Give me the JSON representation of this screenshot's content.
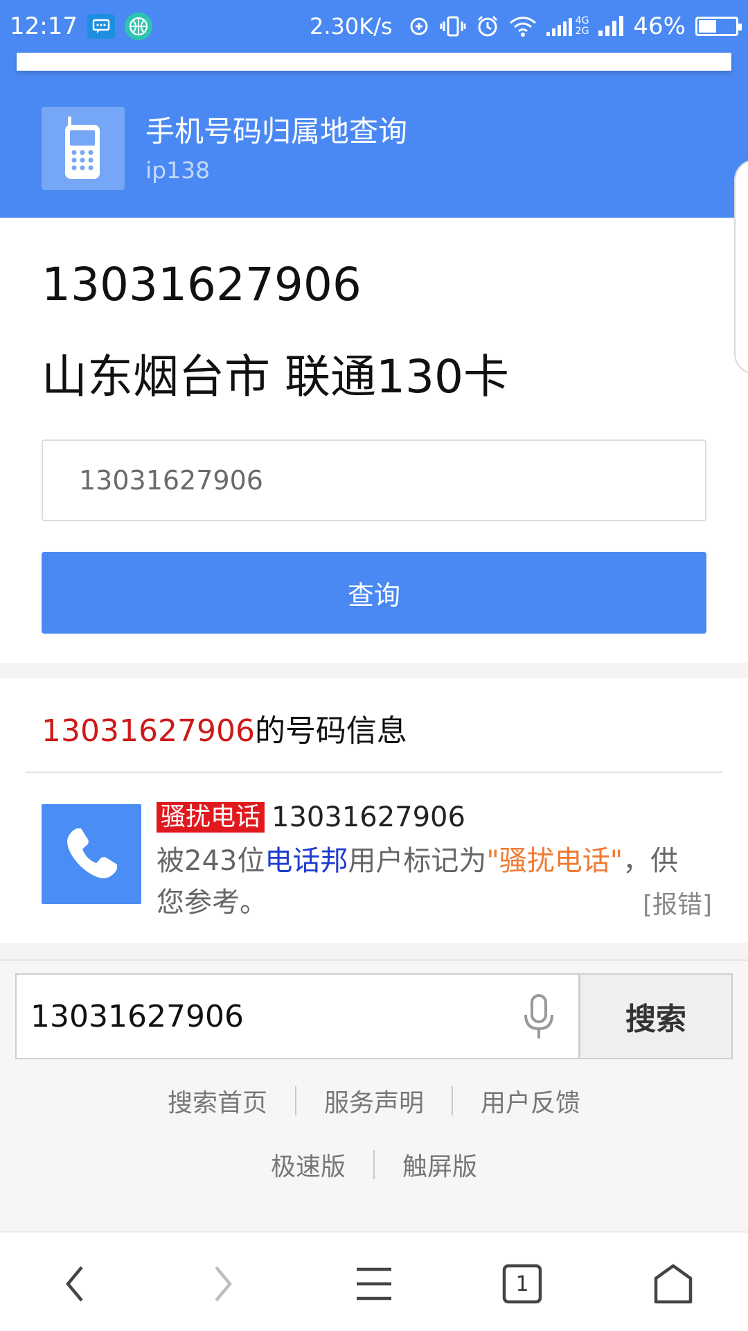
{
  "status_bar": {
    "time": "12:17",
    "speed": "2.30K/s",
    "network_4g": "4G",
    "network_2g": "2G",
    "battery_percent": "46%",
    "battery_level": 0.46
  },
  "header": {
    "title": "手机号码归属地查询",
    "subtitle": "ip138"
  },
  "result": {
    "number": "13031627906",
    "location": "山东烟台市 联通130卡"
  },
  "form": {
    "input_value": "13031627906",
    "query_label": "查询"
  },
  "info": {
    "heading_number": "13031627906",
    "heading_suffix": "的号码信息",
    "tag": "骚扰电话",
    "number": "13031627906",
    "text_prefix": "被243位",
    "text_source": "电话邦",
    "text_middle": "用户标记为",
    "text_tag": "\"骚扰电话\"",
    "text_suffix": "，供您参考。",
    "report_label": "[报错]"
  },
  "search": {
    "value": "13031627906",
    "button_label": "搜索"
  },
  "footer": {
    "row1": [
      "搜索首页",
      "服务声明",
      "用户反馈"
    ],
    "row2": [
      "极速版",
      "触屏版"
    ]
  },
  "nav": {
    "tab_count": "1"
  },
  "colors": {
    "brand_blue": "#4a89f3",
    "highlight_red": "#cc1a1a",
    "tag_red": "#e0191e",
    "link_blue": "#1d3ccf",
    "tag_orange": "#f07a33"
  }
}
